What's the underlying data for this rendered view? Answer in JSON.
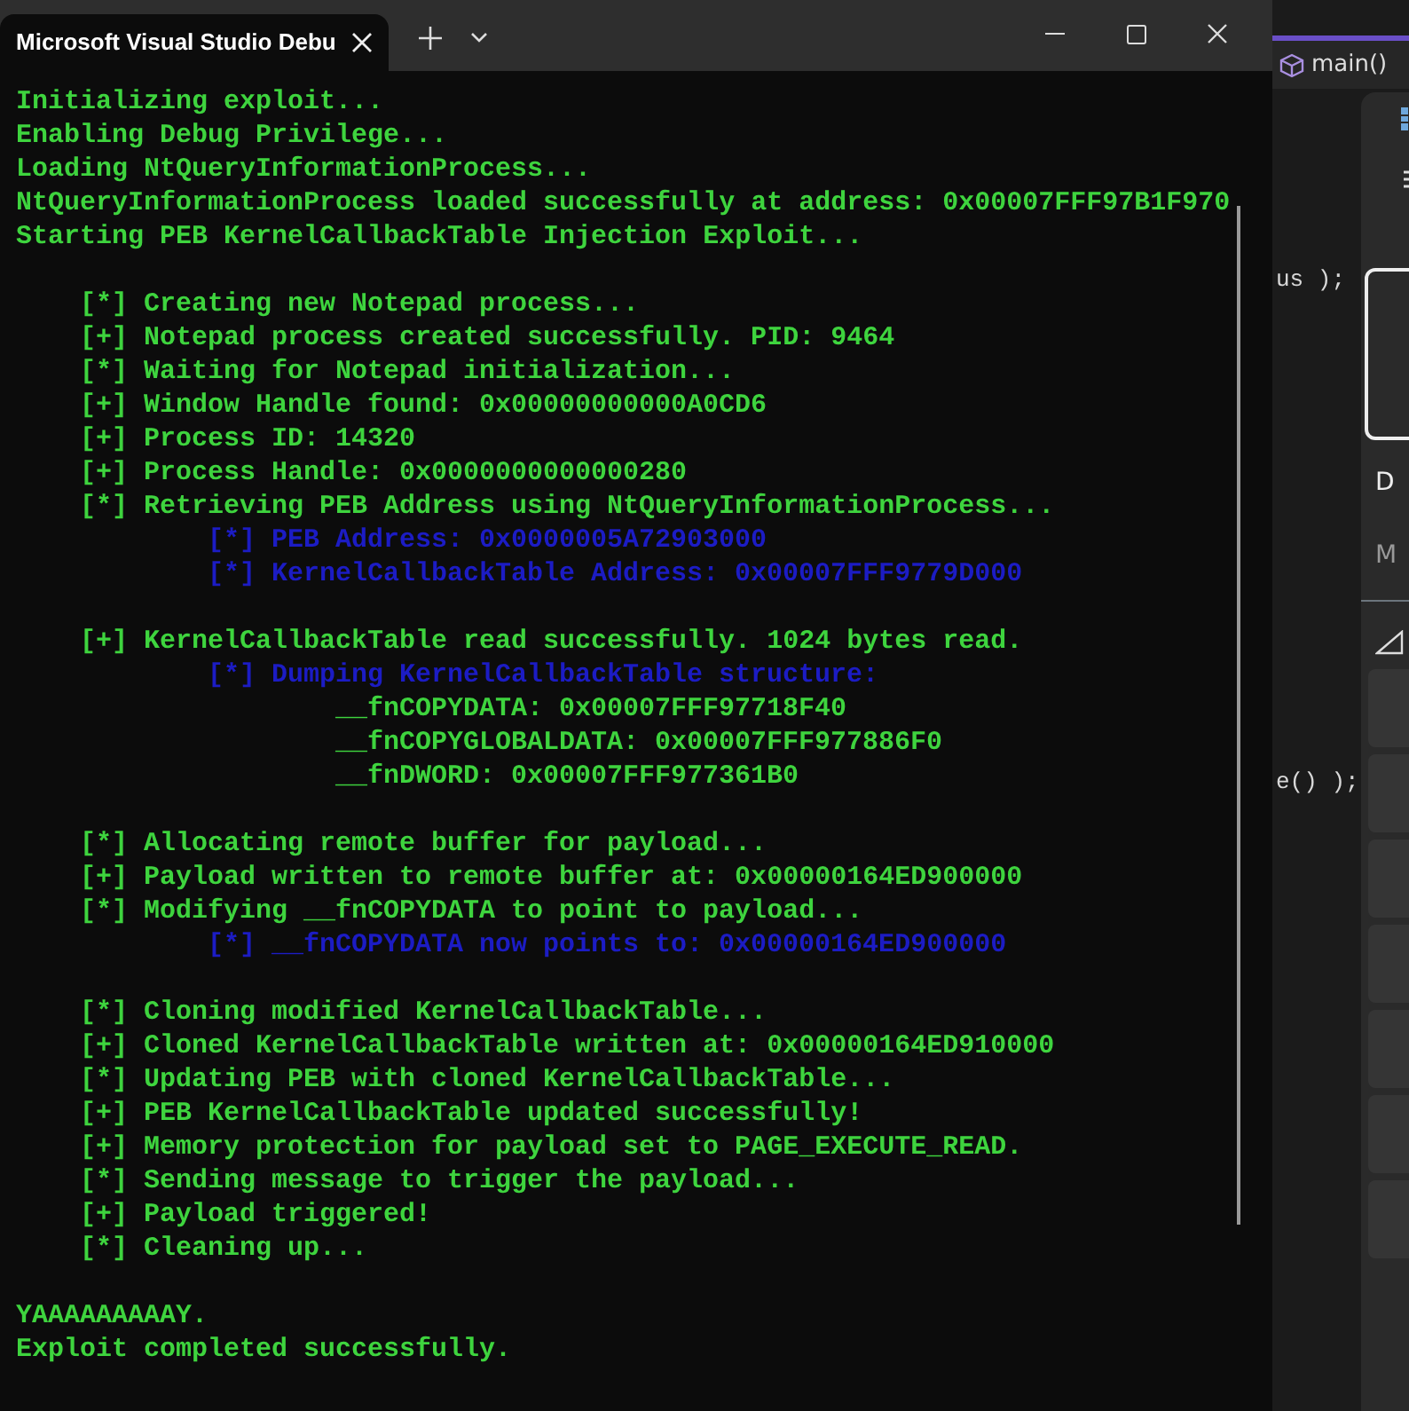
{
  "terminal": {
    "tab_title": "Microsoft Visual Studio Debu",
    "lines": [
      {
        "text": "Initializing exploit...",
        "color": "#3ed43e"
      },
      {
        "text": "Enabling Debug Privilege...",
        "color": "#3ed43e"
      },
      {
        "text": "Loading NtQueryInformationProcess...",
        "color": "#3ed43e"
      },
      {
        "text": "NtQueryInformationProcess loaded successfully at address: 0x00007FFF97B1F970",
        "color": "#3ed43e"
      },
      {
        "text": "Starting PEB KernelCallbackTable Injection Exploit...",
        "color": "#3ed43e",
        "children": [
          {
            "text": "[*] Creating new Notepad process...",
            "color": "#3ed43e",
            "blank_before": true
          },
          {
            "text": "[+] Notepad process created successfully. PID: 9464",
            "color": "#3ed43e"
          },
          {
            "text": "[*] Waiting for Notepad initialization...",
            "color": "#3ed43e"
          },
          {
            "text": "[+] Window Handle found: 0x00000000000A0CD6",
            "color": "#3ed43e"
          },
          {
            "text": "[+] Process ID: 14320",
            "color": "#3ed43e"
          },
          {
            "text": "[+] Process Handle: 0x0000000000000280",
            "color": "#3ed43e"
          },
          {
            "text": "[*] Retrieving PEB Address using NtQueryInformationProcess...",
            "color": "#3ed43e",
            "children": [
              {
                "text": "[*] PEB Address: 0x0000005A72903000",
                "color": "#1c1cc4"
              },
              {
                "text": "[*] KernelCallbackTable Address: 0x00007FFF9779D000",
                "color": "#1c1cc4"
              }
            ]
          },
          {
            "text": "[+] KernelCallbackTable read successfully. 1024 bytes read.",
            "color": "#3ed43e",
            "blank_before": true,
            "children": [
              {
                "text": "[*] Dumping KernelCallbackTable structure:",
                "color": "#1c1cc4",
                "children": [
                  {
                    "text": "__fnCOPYDATA: 0x00007FFF97718F40",
                    "color": "#3ed43e"
                  },
                  {
                    "text": "__fnCOPYGLOBALDATA: 0x00007FFF977886F0",
                    "color": "#3ed43e"
                  },
                  {
                    "text": "__fnDWORD: 0x00007FFF977361B0",
                    "color": "#3ed43e"
                  }
                ]
              }
            ]
          },
          {
            "text": "[*] Allocating remote buffer for payload...",
            "color": "#3ed43e",
            "blank_before": true
          },
          {
            "text": "[+] Payload written to remote buffer at: 0x00000164ED900000",
            "color": "#3ed43e"
          },
          {
            "text": "[*] Modifying __fnCOPYDATA to point to payload...",
            "color": "#3ed43e",
            "children": [
              {
                "text": "[*] __fnCOPYDATA now points to: 0x00000164ED900000",
                "color": "#1c1cc4"
              }
            ]
          },
          {
            "text": "[*] Cloning modified KernelCallbackTable...",
            "color": "#3ed43e",
            "blank_before": true
          },
          {
            "text": "[+] Cloned KernelCallbackTable written at: 0x00000164ED910000",
            "color": "#3ed43e"
          },
          {
            "text": "[*] Updating PEB with cloned KernelCallbackTable...",
            "color": "#3ed43e"
          },
          {
            "text": "[+] PEB KernelCallbackTable updated successfully!",
            "color": "#3ed43e"
          },
          {
            "text": "[+] Memory protection for payload set to PAGE_EXECUTE_READ.",
            "color": "#3ed43e"
          },
          {
            "text": "[*] Sending message to trigger the payload...",
            "color": "#3ed43e"
          },
          {
            "text": "[+] Payload triggered!",
            "color": "#3ed43e"
          },
          {
            "text": "[*] Cleaning up...",
            "color": "#3ed43e"
          }
        ]
      },
      {
        "text": "YAAAAAAAAAY.",
        "color": "#3ed43e",
        "blank_before": true
      },
      {
        "text": "Exploit completed successfully.",
        "color": "#3ed43e"
      }
    ]
  },
  "editor": {
    "breadcrumb": "main()",
    "code_fragments": [
      "us );",
      "e() );"
    ],
    "side_panel_labels": [
      "D",
      "M"
    ]
  }
}
